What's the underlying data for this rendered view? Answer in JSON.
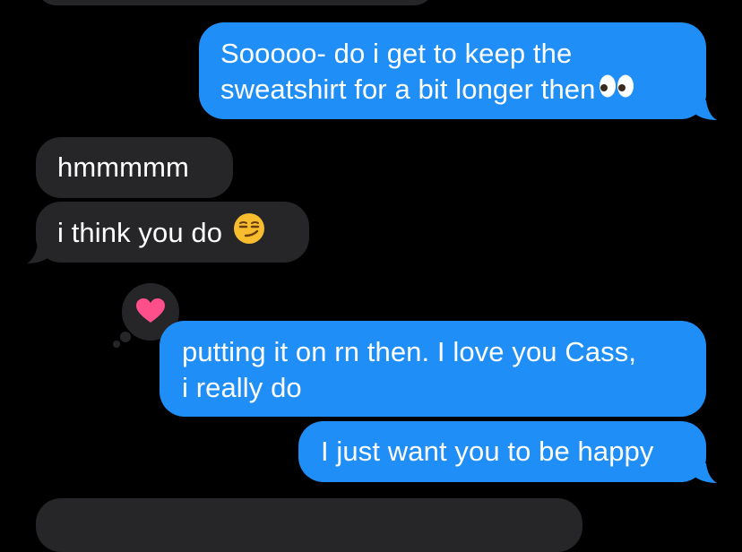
{
  "conversation": {
    "messages": [
      {
        "direction": "sent",
        "lines": [
          "Sooooo- do i get to keep the",
          "sweatshirt for a bit longer then"
        ],
        "emoji": "eyes-emoji"
      },
      {
        "direction": "received",
        "lines": [
          "hmmmmm"
        ]
      },
      {
        "direction": "received",
        "lines": [
          "i think you do"
        ],
        "emoji": "smirk-emoji"
      },
      {
        "direction": "sent",
        "lines": [
          "putting it on rn then. I love you Cass,",
          "i really do"
        ],
        "reaction": "heart-icon"
      },
      {
        "direction": "sent",
        "lines": [
          "I just want you to be happy"
        ]
      }
    ]
  },
  "colors": {
    "background": "#000000",
    "sent_bubble": "#1f8ef6",
    "received_bubble": "#262629",
    "text": "#ffffff",
    "heart": "#ff4f8b"
  }
}
